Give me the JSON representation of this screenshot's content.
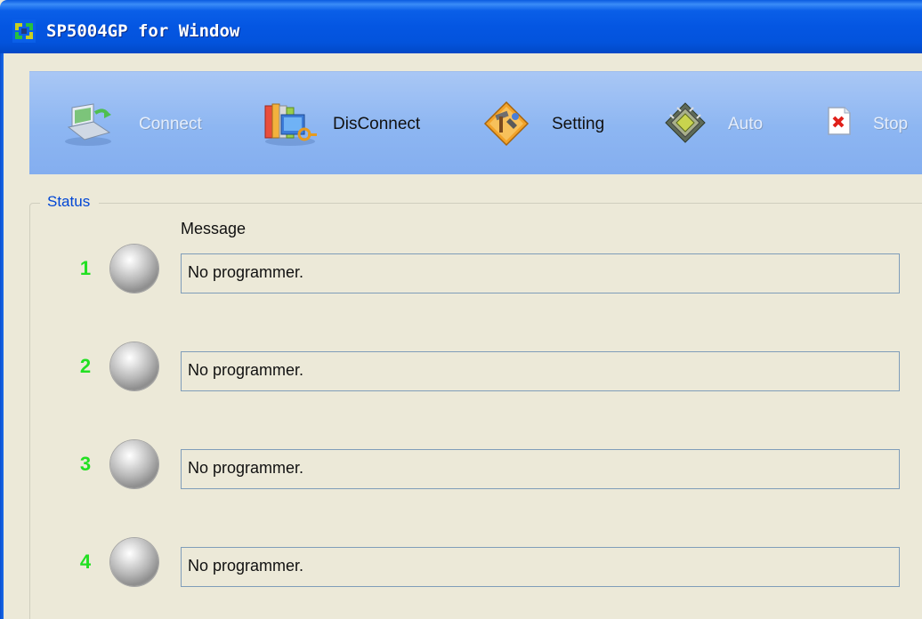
{
  "window": {
    "title": "SP5004GP for Window"
  },
  "toolbar": {
    "connect_label": "Connect",
    "disconnect_label": "DisConnect",
    "setting_label": "Setting",
    "auto_label": "Auto",
    "stop_label": "Stop"
  },
  "status": {
    "group_title": "Status",
    "message_header": "Message",
    "rows": [
      {
        "number": "1",
        "message": "No programmer."
      },
      {
        "number": "2",
        "message": "No programmer."
      },
      {
        "number": "3",
        "message": "No programmer."
      },
      {
        "number": "4",
        "message": "No programmer."
      }
    ]
  },
  "colors": {
    "titlebar": "#0456E2",
    "toolbar": "#8DB6F2",
    "row_number": "#22E022",
    "group_title": "#0046D5",
    "background": "#ECE9D8"
  },
  "icons": {
    "app": "app-logo-icon",
    "connect": "laptop-connect-icon",
    "disconnect": "books-key-icon",
    "setting": "tools-icon",
    "auto": "chip-icon",
    "stop": "red-x-icon",
    "status_led": "gray-led-icon"
  }
}
